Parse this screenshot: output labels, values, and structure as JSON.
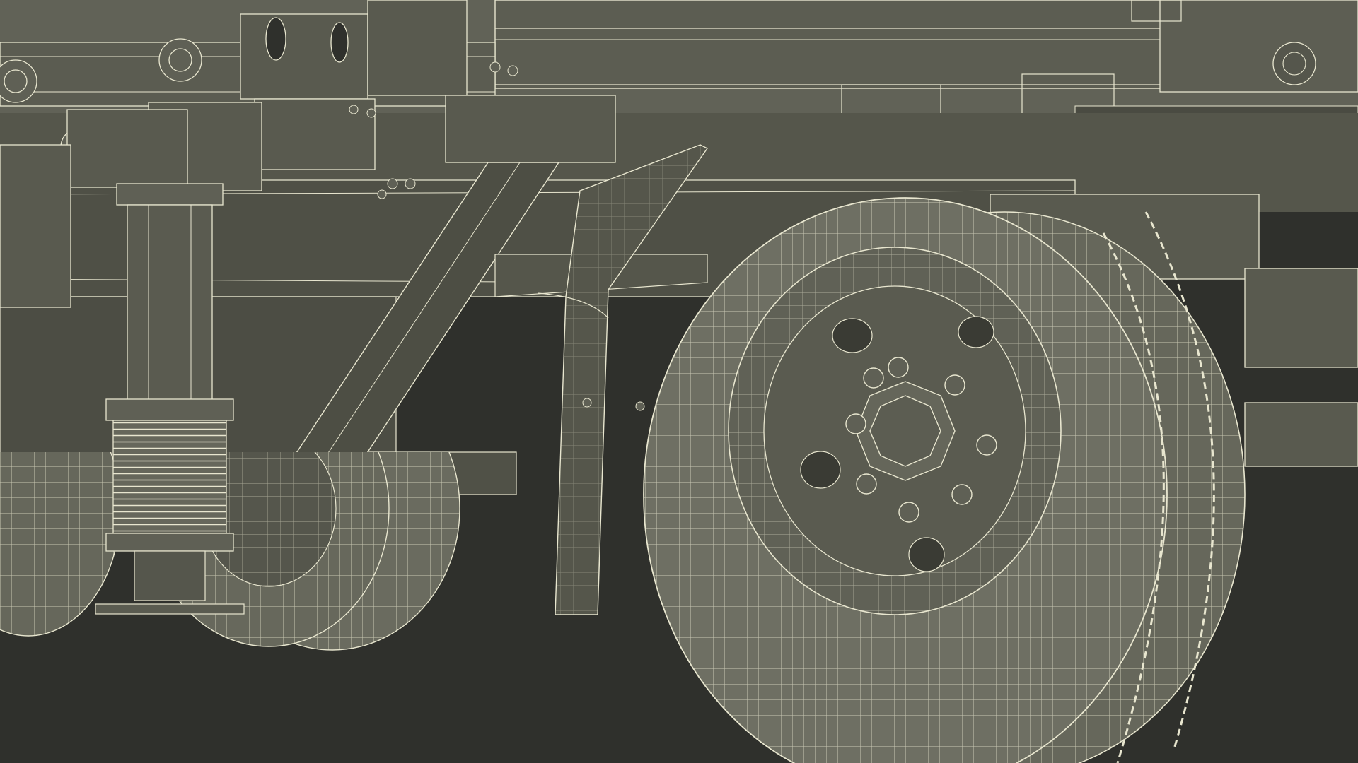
{
  "scene": {
    "colors": {
      "background": "#2f302c",
      "body_fill": "#5e5f54",
      "body_shade": "#505148",
      "body_dark": "#44453d",
      "wire": "#e8e6cf",
      "wire_dim": "#c9c7b0",
      "tire_fill": "#6d6e62",
      "hub_fill": "#5a5b50"
    },
    "objects": [
      "truck-frame-rail",
      "cargo-bed-underside",
      "suspension-strut",
      "front-dual-wheel",
      "rear-dual-wheel",
      "wheel-hub",
      "mudguard",
      "diagonal-brace"
    ]
  }
}
